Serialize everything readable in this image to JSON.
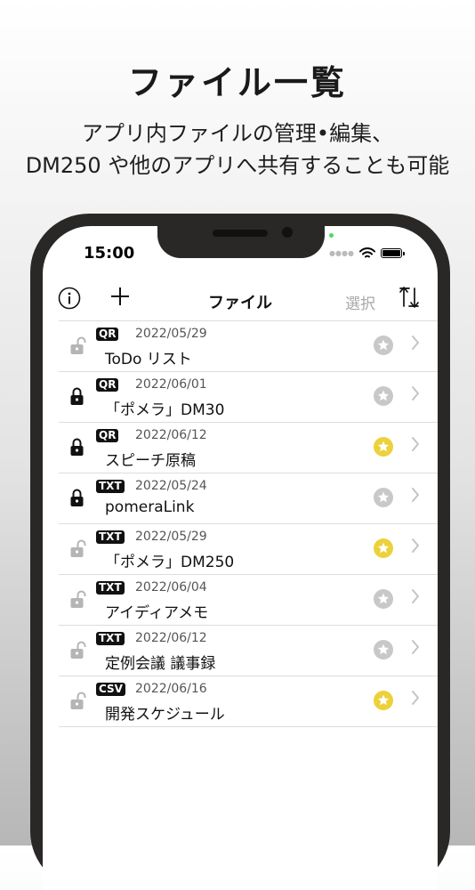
{
  "promo": {
    "headline": "ファイル一覧",
    "subline1": "アプリ内ファイルの管理•編集、",
    "subline2": "DM250 や他のアプリへ共有することも可能"
  },
  "status_bar": {
    "time": "15:00",
    "icons": [
      "signal-dots",
      "wifi-icon",
      "battery-icon"
    ]
  },
  "navbar": {
    "info_icon": "info-icon",
    "add_icon": "plus-icon",
    "title": "ファイル",
    "select_label": "選択",
    "sort_icon": "sort-icon"
  },
  "colors": {
    "badge_bg": "#111111",
    "star_on": "#ecd13a",
    "star_off": "#c8c8c8",
    "lock_on": "#111111",
    "lock_off": "#b5b5b5",
    "select_label": "#a8a8a8"
  },
  "files": [
    {
      "type": "QR",
      "date": "2022/05/29",
      "name": "ToDo リスト",
      "locked": false,
      "starred": false
    },
    {
      "type": "QR",
      "date": "2022/06/01",
      "name": "「ポメラ」DM30",
      "locked": true,
      "starred": false
    },
    {
      "type": "QR",
      "date": "2022/06/12",
      "name": "スピーチ原稿",
      "locked": true,
      "starred": true
    },
    {
      "type": "TXT",
      "date": "2022/05/24",
      "name": "pomeraLink",
      "locked": true,
      "starred": false
    },
    {
      "type": "TXT",
      "date": "2022/05/29",
      "name": "「ポメラ」DM250",
      "locked": false,
      "starred": true
    },
    {
      "type": "TXT",
      "date": "2022/06/04",
      "name": "アイディアメモ",
      "locked": false,
      "starred": false
    },
    {
      "type": "TXT",
      "date": "2022/06/12",
      "name": "定例会議 議事録",
      "locked": false,
      "starred": false
    },
    {
      "type": "CSV",
      "date": "2022/06/16",
      "name": "開発スケジュール",
      "locked": false,
      "starred": true
    }
  ]
}
